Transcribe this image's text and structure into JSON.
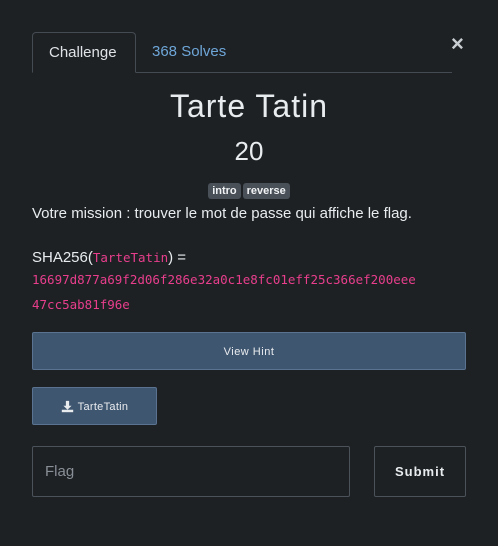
{
  "modal": {
    "close_glyph": "×"
  },
  "tabs": [
    {
      "label": "Challenge",
      "active": true
    },
    {
      "label": "368 Solves",
      "active": false
    }
  ],
  "challenge": {
    "name": "Tarte Tatin",
    "value": "20",
    "tags": [
      "intro",
      "reverse"
    ],
    "description": "Votre mission : trouver le mot de passe qui affiche le flag.",
    "sha_prefix": "SHA256(",
    "sha_arg": "TarteTatin",
    "sha_suffix": ") =",
    "hash_line1": "16697d877a69f2d06f286e32a0c1e8fc01eff25c366ef200eee",
    "hash_line2": "47cc5ab81f96e"
  },
  "hint_button": {
    "label": "View Hint"
  },
  "file_button": {
    "label": "TarteTatin",
    "icon": "download-icon"
  },
  "flag_form": {
    "placeholder": "Flag",
    "value": "",
    "submit_label": "Submit"
  },
  "colors": {
    "background": "#1d2124",
    "link": "#6ea6d8",
    "code": "#e83e8c",
    "button": "#3f5670",
    "tag": "#495057"
  }
}
